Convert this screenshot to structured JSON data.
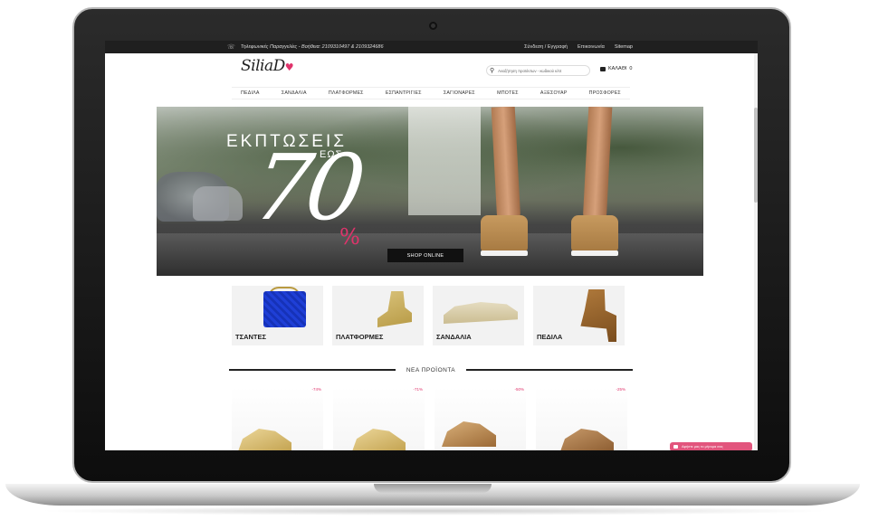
{
  "topbar": {
    "phone_text": "Τηλεφωνικές Παραγγελίες - Βοήθεια: 2109310497 & 2109324686",
    "links": [
      "Σύνδεση / Εγγραφή",
      "Επικοινωνία",
      "Sitemap"
    ]
  },
  "header": {
    "logo": "SiliaD",
    "search_placeholder": "Αναζήτηση προϊόντων - κωδικού κλπ",
    "cart_label": "ΚΑΛΑΘΙ",
    "cart_count": "0"
  },
  "nav": {
    "items": [
      "ΠΕΔΙΛΑ",
      "ΣΑΝΔΑΛΙΑ",
      "ΠΛΑΤΦΟΡΜΕΣ",
      "ΕΣΠΑΝΤΡΙΓΙΕΣ",
      "ΣΑΓΙΟΝΑΡΕΣ",
      "ΜΠΟΤΕΣ",
      "ΑΞΕΣΟΥΑΡ",
      "ΠΡΟΣΦΟΡΕΣ"
    ]
  },
  "hero": {
    "title": "ΕΚΠΤΩΣΕΙΣ",
    "subtitle": "ΕΩΣ",
    "big_number": "70",
    "percent": "%",
    "button": "SHOP ONLINE"
  },
  "categories": [
    "ΤΣΑΝΤΕΣ",
    "ΠΛΑΤΦΟΡΜΕΣ",
    "ΣΑΝΔΑΛΙΑ",
    "ΠΕΔΙΛΑ"
  ],
  "new_products": {
    "title": "ΝΕΑ ΠΡΟΪΟΝΤΑ",
    "discounts": [
      "-74%",
      "-71%",
      "-50%",
      "-25%"
    ]
  },
  "chat": {
    "label": "Αφήστε μας το μήνυμα σας"
  },
  "colors": {
    "accent": "#e0336b",
    "topbar": "#1f1f1f"
  }
}
